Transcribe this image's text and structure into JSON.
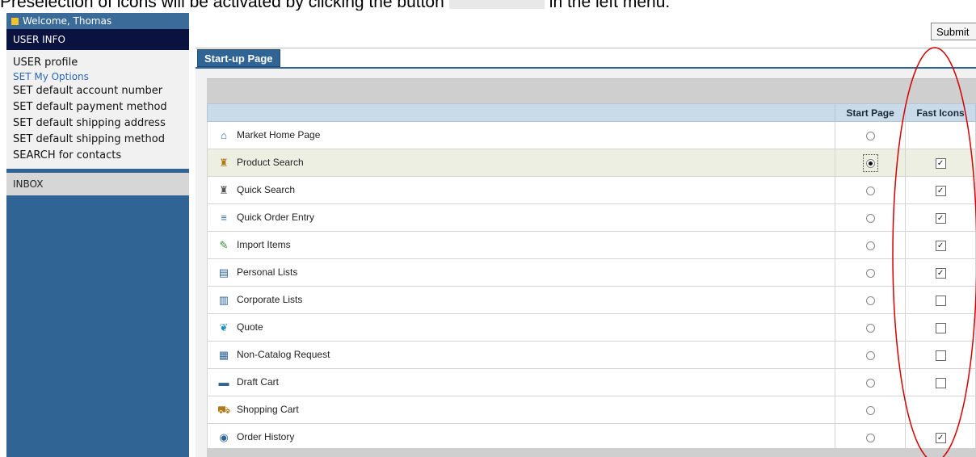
{
  "caption": {
    "before": "Preselection of icons will be activated by clicking the button",
    "after": "in the left menu."
  },
  "sidebar": {
    "welcome": "Welcome, Thomas",
    "user_info_header": "USER INFO",
    "items": [
      {
        "label": "USER profile"
      },
      {
        "label": "SET My Options"
      },
      {
        "label": "SET default account number"
      },
      {
        "label": "SET default payment method"
      },
      {
        "label": "SET default shipping address"
      },
      {
        "label": "SET default shipping method"
      },
      {
        "label": "SEARCH for contacts"
      }
    ],
    "inbox_header": "INBOX"
  },
  "submit_label": "Submit",
  "tab_label": "Start-up Page",
  "table": {
    "headers": {
      "start_page": "Start Page",
      "fast_icons": "Fast Icons"
    },
    "rows": [
      {
        "label": "Market Home Page",
        "icon": "home-icon",
        "start_page": false,
        "fast_icon": null
      },
      {
        "label": "Product Search",
        "icon": "binoculars-icon",
        "start_page": true,
        "fast_icon": true
      },
      {
        "label": "Quick Search",
        "icon": "quick-search-icon",
        "start_page": false,
        "fast_icon": true
      },
      {
        "label": "Quick Order Entry",
        "icon": "quick-order-icon",
        "start_page": false,
        "fast_icon": true
      },
      {
        "label": "Import Items",
        "icon": "import-icon",
        "start_page": false,
        "fast_icon": true
      },
      {
        "label": "Personal Lists",
        "icon": "personal-list-icon",
        "start_page": false,
        "fast_icon": true
      },
      {
        "label": "Corporate Lists",
        "icon": "corporate-list-icon",
        "start_page": false,
        "fast_icon": false
      },
      {
        "label": "Quote",
        "icon": "quote-icon",
        "start_page": false,
        "fast_icon": false
      },
      {
        "label": "Non-Catalog Request",
        "icon": "non-catalog-icon",
        "start_page": false,
        "fast_icon": false
      },
      {
        "label": "Draft Cart",
        "icon": "draft-cart-icon",
        "start_page": false,
        "fast_icon": false
      },
      {
        "label": "Shopping Cart",
        "icon": "shopping-cart-icon",
        "start_page": false,
        "fast_icon": null
      },
      {
        "label": "Order History",
        "icon": "order-history-icon",
        "start_page": false,
        "fast_icon": true
      }
    ]
  },
  "colors": {
    "sidebar_bg": "#2f6494",
    "header_dark": "#0a1240",
    "table_header": "#c9dbe9",
    "selected_row": "#eeefe3",
    "annotation_red": "#d40000"
  }
}
